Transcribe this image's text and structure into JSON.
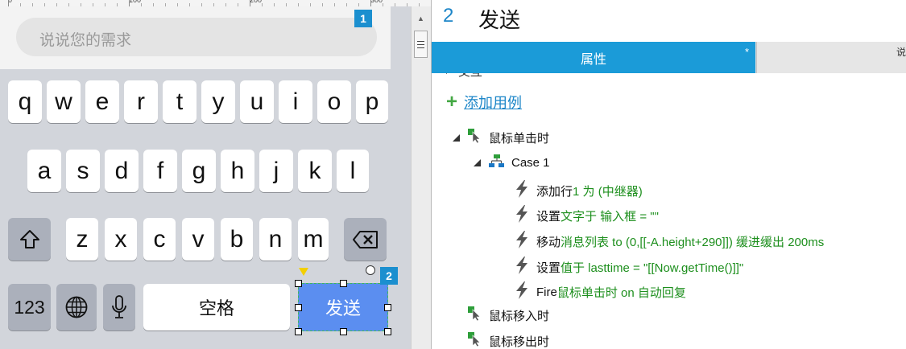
{
  "ruler": {
    "labels": [
      "0",
      "100",
      "200",
      "300"
    ]
  },
  "search": {
    "placeholder": "说说您的需求"
  },
  "badges": {
    "first": "1",
    "second": "2"
  },
  "keyboard": {
    "row1": [
      "q",
      "w",
      "e",
      "r",
      "t",
      "y",
      "u",
      "i",
      "o",
      "p"
    ],
    "row2": [
      "a",
      "s",
      "d",
      "f",
      "g",
      "h",
      "j",
      "k",
      "l"
    ],
    "row3": [
      "z",
      "x",
      "c",
      "v",
      "b",
      "n",
      "m"
    ],
    "numbers_key": "123",
    "space_key": "空格",
    "send_key": "发送",
    "icons": [
      "shift-icon",
      "backspace-icon",
      "globe-icon",
      "microphone-icon"
    ],
    "send_color": "#5b8ef0"
  },
  "panel": {
    "number": "2",
    "name": "发送",
    "tab_properties": "属性",
    "tab_modified_mark": "*",
    "tab_partial_label": "说",
    "collapsed_row": "交互",
    "add_case": "添加用例",
    "accent_color": "#1b9bd8",
    "events": [
      {
        "label": "鼠标单击时",
        "case": "Case 1",
        "actions": [
          {
            "verb": "添加行 ",
            "detail": "1 为 (中继器)"
          },
          {
            "verb": "设置 ",
            "detail": "文字于 输入框 = \"\""
          },
          {
            "verb": "移动 ",
            "detail": "消息列表 to (0,[[-A.height+290]]) 缓进缓出 200ms"
          },
          {
            "verb": "设置 ",
            "detail": "值于 lasttime = \"[[Now.getTime()]]\""
          },
          {
            "verb": "Fire ",
            "detail": "鼠标单击时 on 自动回复"
          }
        ]
      },
      {
        "label": "鼠标移入时"
      },
      {
        "label": "鼠标移出时"
      }
    ]
  }
}
